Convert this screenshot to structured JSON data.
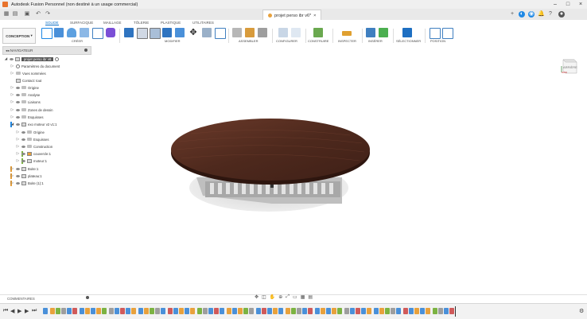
{
  "window": {
    "title": "Autodesk Fusion Personnel (non destiné à un usage commercial)",
    "controls": [
      "–",
      "□",
      "×"
    ]
  },
  "document": {
    "tab_title": "projet perso ibr v6*"
  },
  "ribbon": {
    "tabs": [
      "SOLIDE",
      "SURFACIQUE",
      "MAILLAGE",
      "TÔLERIE",
      "PLASTIQUE",
      "UTILITAIRES"
    ],
    "active_tab": "SOLIDE",
    "workspace": "CONCEPTION",
    "groups": [
      "CRÉER",
      "MODIFIER",
      "ASSEMBLER",
      "CONFIGURER",
      "CONSTRUIRE",
      "INSPECTER",
      "INSÉRER",
      "SÉLECTIONNER",
      "POSITION"
    ]
  },
  "navigator": {
    "title": "NAVIGATEUR",
    "items": [
      {
        "label": "projet perso ibr v6"
      },
      {
        "label": "Paramètres du document"
      },
      {
        "label": "Vues nommées"
      },
      {
        "label": "Contact: tout"
      },
      {
        "label": "Origine"
      },
      {
        "label": "Analyse"
      },
      {
        "label": "Liaisons"
      },
      {
        "label": "Zones de dessin"
      },
      {
        "label": "Esquisses"
      },
      {
        "label": "exo moteur v2 v1:1"
      },
      {
        "label": "Origine"
      },
      {
        "label": "Esquisses"
      },
      {
        "label": "Construction"
      },
      {
        "label": "couvercle:1"
      },
      {
        "label": "moteur:1"
      },
      {
        "label": "Boite:1"
      },
      {
        "label": "plateau:1"
      },
      {
        "label": "Boite (1):1"
      }
    ]
  },
  "viewcube": {
    "face": "ARRIÈRE"
  },
  "comments": {
    "label": "COMMENTAIRES"
  },
  "colors": {
    "accent": "#0b6fc5",
    "wood": "#5a2f22"
  }
}
